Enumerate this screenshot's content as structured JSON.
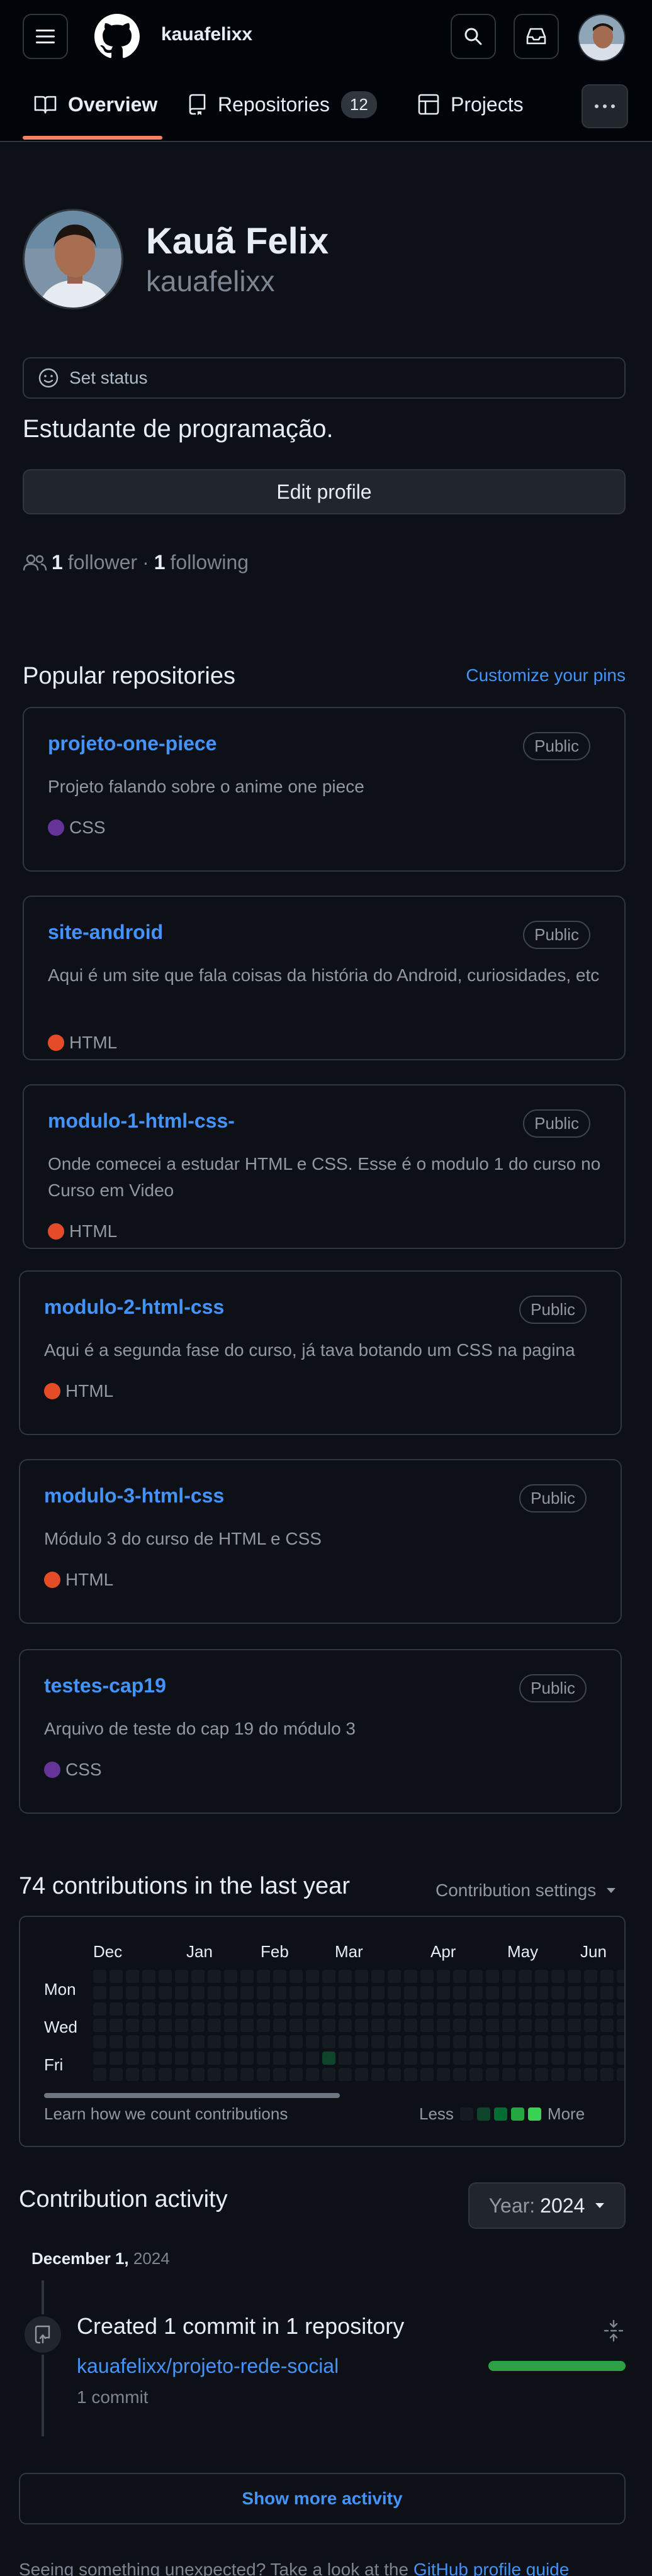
{
  "header": {
    "username": "kauafelixx",
    "tabs": [
      {
        "label": "Overview"
      },
      {
        "label": "Repositories",
        "count": "12"
      },
      {
        "label": "Projects"
      }
    ]
  },
  "profile": {
    "full_name": "Kauã Felix",
    "login": "kauafelixx",
    "status_label": "Set status",
    "bio": "Estudante de programação.",
    "edit_label": "Edit profile",
    "followers_count": "1",
    "followers_label": "follower",
    "separator": "·",
    "following_count": "1",
    "following_label": "following"
  },
  "popular": {
    "title": "Popular repositories",
    "customize": "Customize your pins",
    "repos": [
      {
        "name": "projeto-one-piece",
        "visibility": "Public",
        "description": "Projeto falando sobre o anime one piece",
        "language": "CSS",
        "lang_color": "#663399"
      },
      {
        "name": "site-android",
        "visibility": "Public",
        "description": "Aqui é um site que fala coisas da história do Android, curiosidades, etc",
        "language": "HTML",
        "lang_color": "#e34c26"
      },
      {
        "name": "modulo-1-html-css-",
        "visibility": "Public",
        "description": "Onde comecei a estudar HTML e CSS. Esse é o modulo 1 do curso no Curso em Video",
        "language": "HTML",
        "lang_color": "#e34c26"
      },
      {
        "name": "modulo-2-html-css",
        "visibility": "Public",
        "description": "Aqui é a segunda fase do curso, já tava botando um CSS na pagina",
        "language": "HTML",
        "lang_color": "#e34c26"
      },
      {
        "name": "modulo-3-html-css",
        "visibility": "Public",
        "description": "Módulo 3 do curso de HTML e CSS",
        "language": "HTML",
        "lang_color": "#e34c26"
      },
      {
        "name": "testes-cap19",
        "visibility": "Public",
        "description": "Arquivo de teste do cap 19 do módulo 3",
        "language": "CSS",
        "lang_color": "#663399"
      }
    ]
  },
  "contributions": {
    "title": "74 contributions in the last year",
    "settings": "Contribution settings",
    "months": [
      "Dec",
      "Jan",
      "Feb",
      "Mar",
      "Apr",
      "May",
      "Jun"
    ],
    "days": [
      "Mon",
      "Wed",
      "Fri"
    ],
    "learn": "Learn how we count contributions",
    "less": "Less",
    "more": "More",
    "colors": {
      "empty": "#161b22",
      "l1": "#0e4429",
      "l2": "#006d32",
      "l3": "#26a641",
      "l4": "#39d353"
    }
  },
  "activity": {
    "title": "Contribution activity",
    "year_prefix": "Year:",
    "year": "2024",
    "date_month": "December 1,",
    "date_year": "2024",
    "event_title": "Created 1 commit in 1 repository",
    "repo": "kauafelixx/projeto-rede-social",
    "commits": "1 commit",
    "show_more": "Show more activity"
  },
  "footer": {
    "text": "Seeing something unexpected? Take a look at the",
    "link": "GitHub profile guide"
  }
}
